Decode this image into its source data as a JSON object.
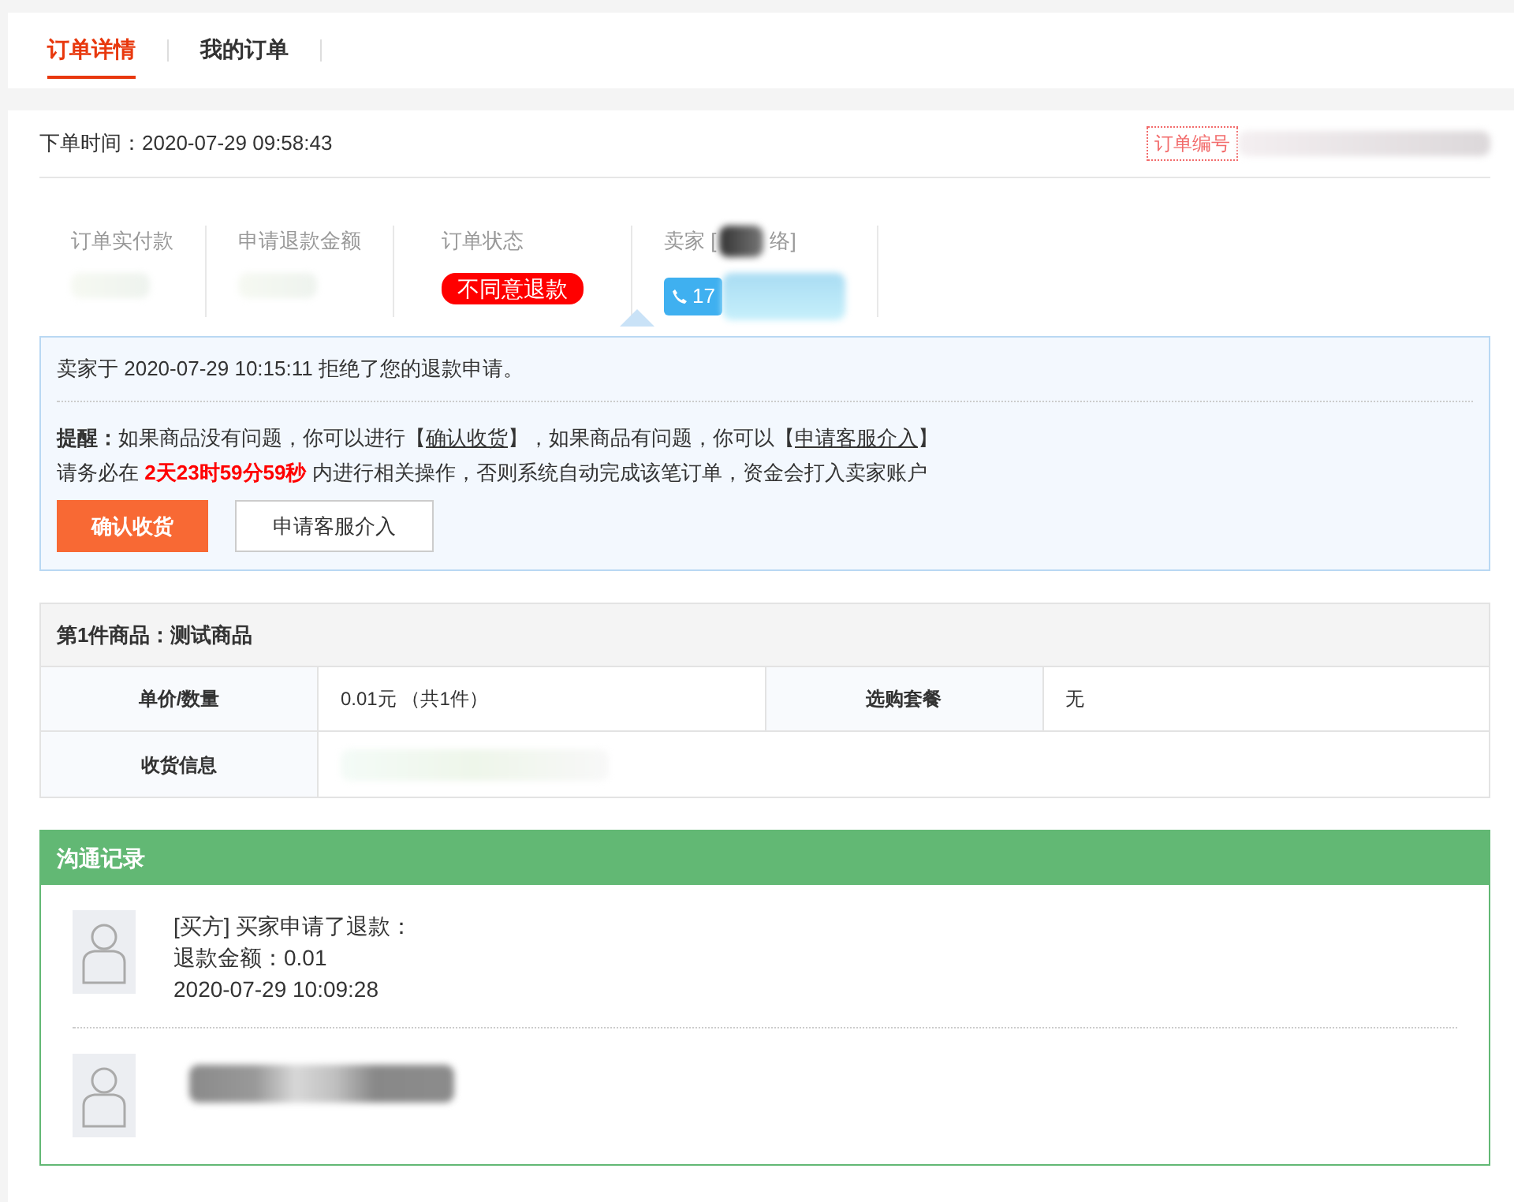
{
  "tabs": [
    {
      "label": "订单详情",
      "selected": true
    },
    {
      "label": "我的订单",
      "selected": false
    }
  ],
  "order_time": "下单时间：2020-07-29 09:58:43",
  "order_number_label": "订单编号",
  "summary": [
    {
      "kind": "redacted",
      "label": "订单实付款"
    },
    {
      "kind": "redacted",
      "label": "申请退款金额"
    },
    {
      "kind": "status",
      "label": "订单状态",
      "value": "不同意退款"
    },
    {
      "kind": "seller",
      "label_start": "卖家 [",
      "label_end": "络]",
      "phone": "17"
    }
  ],
  "notice": {
    "message": "卖家于 2020-07-29 10:15:11 拒绝了您的退款申请。",
    "reminder_label": "提醒：",
    "reminder_parts": [
      {
        "text": "如果商品没有问题，你可以进行【",
        "link": false
      },
      {
        "text": "确认收货",
        "link": true
      },
      {
        "text": "】，如果商品有问题，你可以【",
        "link": false
      },
      {
        "text": "申请客服介入",
        "link": true
      },
      {
        "text": "】",
        "link": false
      }
    ],
    "deadline_before": "请务必在 ",
    "deadline": "2天23时59分59秒",
    "deadline_after": " 内进行相关操作，否则系统自动完成该笔订单，资金会打入卖家账户",
    "buttons": [
      {
        "label": "确认收货",
        "kind": "primary"
      },
      {
        "label": "申请客服介入",
        "kind": "secondary"
      }
    ]
  },
  "product": {
    "title": "第1件商品：测试商品",
    "cells": [
      {
        "label": "单价/数量",
        "value": "0.01元 （共1件）"
      },
      {
        "label": "选购套餐",
        "value": "无"
      }
    ],
    "address_label": "收货信息"
  },
  "log": {
    "title": "沟通记录",
    "entries": [
      {
        "kind": "text",
        "lines": [
          "[买方] 买家申请了退款：",
          "退款金额：0.01",
          "2020-07-29 10:09:28"
        ]
      },
      {
        "kind": "redacted"
      }
    ]
  }
}
